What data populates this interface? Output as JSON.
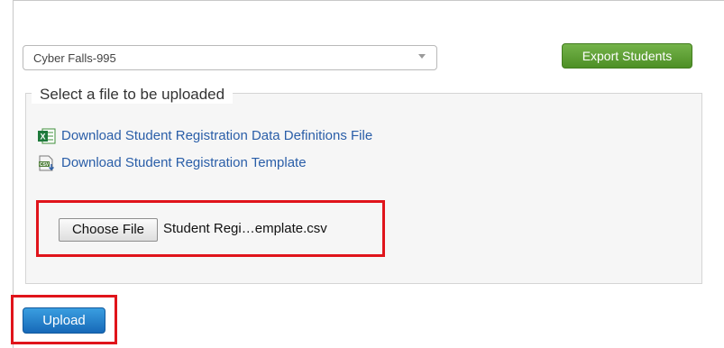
{
  "school_select": {
    "selected": "Cyber Falls-995"
  },
  "export_button": "Export Students",
  "upload_section": {
    "legend": "Select a file to be uploaded",
    "links": [
      {
        "label": "Download Student Registration Data Definitions File",
        "icon": "excel-file-icon"
      },
      {
        "label": "Download Student Registration Template",
        "icon": "csv-file-icon"
      }
    ]
  },
  "file_input": {
    "button_label": "Choose File",
    "file_name": "Student Regi…emplate.csv"
  },
  "upload_button": "Upload",
  "colors": {
    "export_green": "#5a9e33",
    "upload_blue": "#1f7ac9",
    "link_blue": "#2a5ea8",
    "highlight_red": "#e0141b"
  }
}
